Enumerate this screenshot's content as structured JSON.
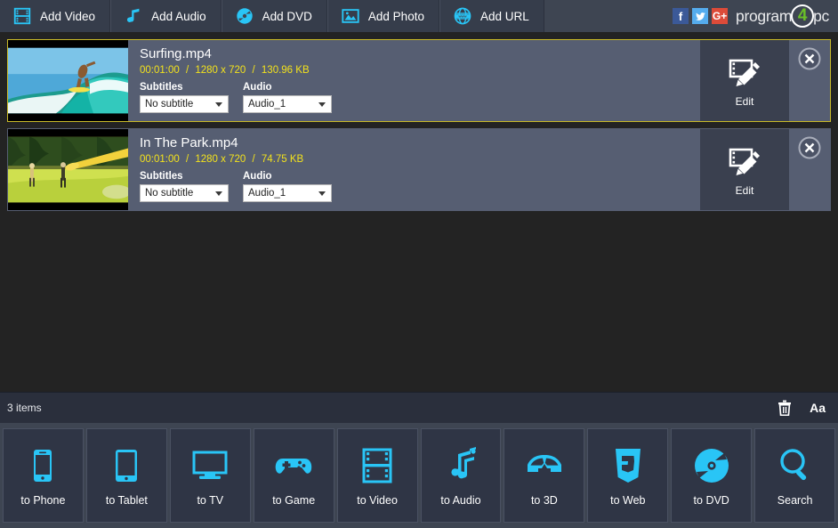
{
  "header": {
    "tabs": [
      {
        "label": "Add Video",
        "icon": "film-strip-icon"
      },
      {
        "label": "Add Audio",
        "icon": "music-note-icon"
      },
      {
        "label": "Add DVD",
        "icon": "dvd-disc-icon"
      },
      {
        "label": "Add Photo",
        "icon": "photo-image-icon"
      },
      {
        "label": "Add URL",
        "icon": "globe-www-icon"
      }
    ],
    "social": [
      {
        "name": "facebook-icon",
        "glyph": "f",
        "color": "#3b5998"
      },
      {
        "name": "twitter-icon",
        "glyph": "ᵛ",
        "color": "#55acee"
      },
      {
        "name": "googleplus-icon",
        "glyph": "G+",
        "color": "#dd4b39"
      }
    ],
    "logo": {
      "pre": "program",
      "four": "4",
      "post": "pc"
    }
  },
  "list": {
    "rows": [
      {
        "filename": "Surfing.mp4",
        "duration": "00:01:00",
        "resolution": "1280 x 720",
        "filesize": "130.96 KB",
        "subtitles_label": "Subtitles",
        "subtitles_value": "No subtitle",
        "audio_label": "Audio",
        "audio_value": "Audio_1",
        "edit_label": "Edit",
        "selected": true,
        "thumb": "surfing-wave-thumbnail"
      },
      {
        "filename": "In The Park.mp4",
        "duration": "00:01:00",
        "resolution": "1280 x 720",
        "filesize": "74.75 KB",
        "subtitles_label": "Subtitles",
        "subtitles_value": "No subtitle",
        "audio_label": "Audio",
        "audio_value": "Audio_1",
        "edit_label": "Edit",
        "selected": false,
        "thumb": "park-frisbee-thumbnail"
      }
    ],
    "separator": "/"
  },
  "status": {
    "items_count": "3  items",
    "delete_icon": "trash-can-icon",
    "font_label": "Aa"
  },
  "tiles": [
    {
      "label": "to Phone",
      "icon": "phone-icon"
    },
    {
      "label": "to Tablet",
      "icon": "tablet-icon"
    },
    {
      "label": "to TV",
      "icon": "tv-monitor-icon"
    },
    {
      "label": "to Game",
      "icon": "gamepad-icon"
    },
    {
      "label": "to Video",
      "icon": "film-strip-icon"
    },
    {
      "label": "to Audio",
      "icon": "music-notes-icon"
    },
    {
      "label": "to 3D",
      "icon": "3d-glasses-icon"
    },
    {
      "label": "to Web",
      "icon": "html5-shield-icon"
    },
    {
      "label": "to DVD",
      "icon": "dvd-disc-icon"
    },
    {
      "label": "Search",
      "icon": "magnifier-icon"
    }
  ],
  "colors": {
    "accent_cyan": "#29c5f6",
    "header_bg": "#3e4552",
    "row_bg": "#565e72",
    "list_bg": "#232323",
    "selection": "#c9ba28",
    "meta_yellow": "#f3e21c"
  }
}
